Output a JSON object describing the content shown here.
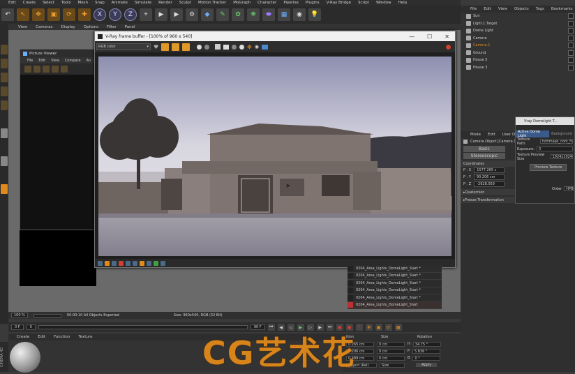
{
  "menubar": {
    "items": [
      "Edit",
      "Create",
      "Select",
      "Tools",
      "Mesh",
      "Snap",
      "Animate",
      "Simulate",
      "Render",
      "Sculpt",
      "Motion Tracker",
      "MoGraph",
      "Character",
      "Pipeline",
      "Plugins",
      "V-Ray Bridge",
      "Script",
      "Window",
      "Help"
    ]
  },
  "toolbar": {
    "axis": [
      "X",
      "Y",
      "Z"
    ]
  },
  "viewport_menu": {
    "items": [
      "View",
      "Cameras",
      "Display",
      "Options",
      "Filter",
      "Panel"
    ]
  },
  "picture_viewer": {
    "title": "Picture Viewer",
    "menu": [
      "File",
      "Edit",
      "View",
      "Compare",
      "An"
    ]
  },
  "vfb": {
    "title": "V-Ray frame buffer - [100% of 960 x 540]",
    "channel": "RGB color",
    "controls": {
      "minimize": "—",
      "maximize": "☐",
      "close": "✕"
    }
  },
  "render_list": {
    "items": [
      "0204_Area_Lights_DomeLight_Start *",
      "0204_Area_Lights_DomeLight_Start *",
      "0204_Area_Lights_DomeLight_Start *",
      "0204_Area_Lights_DomeLight_Start *",
      "0204_Area_Lights_DomeLight_Start *",
      "0204_Area_Lights_DomeLight_Start"
    ]
  },
  "timeline": {
    "zoom": "100 %",
    "status": "00:00:10 All Objects Exported",
    "size": "Size: 960x540, RGB (32 Bit)"
  },
  "framebar": {
    "start": "0 F",
    "current": "0",
    "end": "90 F"
  },
  "material": {
    "menu": [
      "Create",
      "Edit",
      "Function",
      "Texture"
    ]
  },
  "coordinates": {
    "headers": [
      "ition",
      "Size",
      "Rotation"
    ],
    "rows": [
      {
        "pos": "0.265 cm",
        "size": "0 cm",
        "rot_label": "H",
        "rot": "34.75 °"
      },
      {
        "pos": "0.206 cm",
        "size": "0 cm",
        "rot_label": "P",
        "rot": "5.836 °"
      },
      {
        "pos": "0.489 cm",
        "size": "0 cm",
        "rot_label": "B",
        "rot": "0 °"
      }
    ],
    "mode": "Object (Rel)",
    "size_mode": "Size",
    "apply": "Apply"
  },
  "object_manager": {
    "menu": [
      "File",
      "Edit",
      "View",
      "Objects",
      "Tags",
      "Bookmarks"
    ],
    "objects": [
      "Sun",
      "Light.1.Target",
      "Dome Light",
      "Camera",
      "Camera.1",
      "Ground",
      "House 5",
      "House 3"
    ]
  },
  "attributes": {
    "menu": [
      "Mode",
      "Edit",
      "User Da"
    ],
    "object_label": "Camera Object [Camera.1]",
    "tabs": [
      "Basic",
      "Stereoscopic"
    ],
    "section": "Coordinates",
    "coords": [
      {
        "label": "P . X",
        "value": "1577.265 c"
      },
      {
        "label": "P . Y",
        "value": "90.206 cm"
      },
      {
        "label": "P . Z",
        "value": "-2928.059"
      }
    ],
    "collapsed": [
      "Quaternion",
      "Freeze Transformation"
    ]
  },
  "dome": {
    "title": "Vray Domelight T...",
    "tabs": [
      "Active Dome Light",
      "Background"
    ],
    "texture_path_label": "Texture Path:",
    "texture_path": "hdrimaps_com_fr",
    "exposure_label": "Exposure:",
    "exposure": "0",
    "preview_size_label": "Texture Preview Size",
    "preview_size": "1024x1024",
    "preview_button": "Preview Texture",
    "order_label": "Order",
    "order": "HPB"
  },
  "watermark": "CG艺术花",
  "side_label": "CINEMA 4D"
}
